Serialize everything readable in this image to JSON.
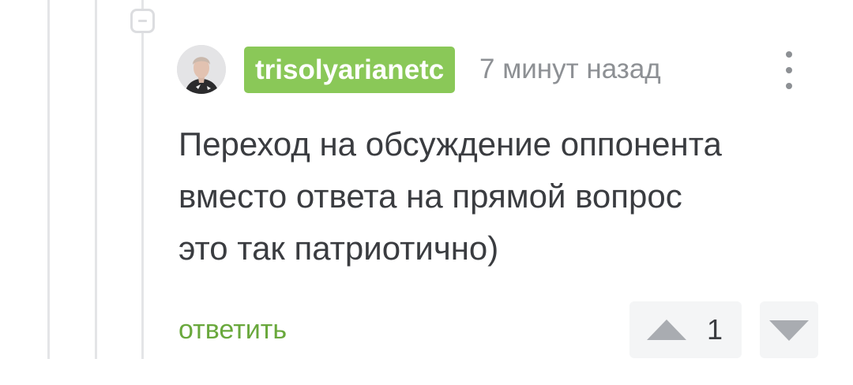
{
  "comment": {
    "author": "trisolyarianetc",
    "time_ago": "7 минут назад",
    "text": "Переход на обсуждение оппонента\nвместо ответа на прямой вопрос\nэто так патриотично)",
    "reply_label": "ответить",
    "rating": "1"
  },
  "icons": {
    "collapse": "minus-square-icon",
    "more": "more-vertical-icon",
    "upvote": "triangle-up-icon",
    "downvote": "triangle-down-icon"
  },
  "colors": {
    "username_badge": "#8ac858",
    "reply_link": "#69a83c",
    "text": "#3a3c40",
    "meta": "#8d9094",
    "vote_button_bg": "#f4f5f6",
    "vote_icon": "#a9acb1",
    "thread_line": "#e4e5e7"
  }
}
